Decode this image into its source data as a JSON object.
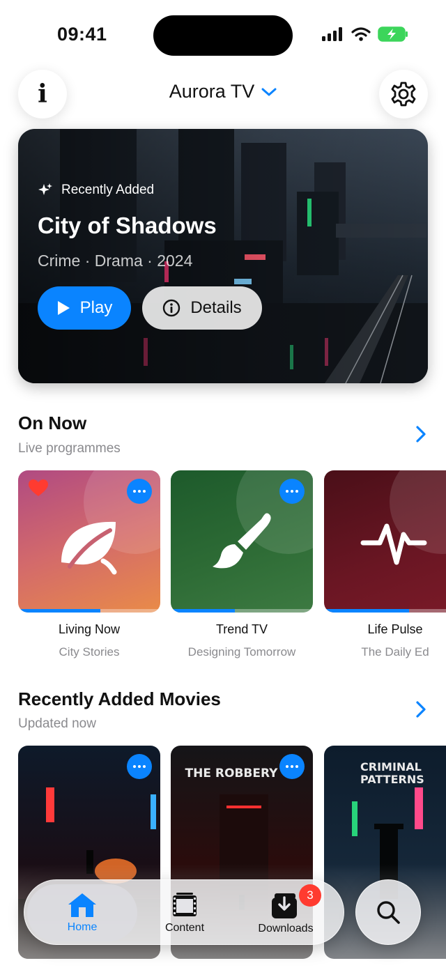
{
  "status_bar": {
    "time": "09:41"
  },
  "header": {
    "title": "Aurora TV",
    "info_icon": "info-icon",
    "settings_icon": "gear-icon"
  },
  "hero": {
    "tag": "Recently Added",
    "title": "City of Shadows",
    "meta": "Crime · Drama · 2024",
    "play_label": "Play",
    "details_label": "Details"
  },
  "on_now": {
    "title": "On Now",
    "subtitle": "Live programmes",
    "items": [
      {
        "title": "Living Now",
        "subtitle": "City Stories",
        "icon": "leaf-icon",
        "favorite": true,
        "progress": 0.58
      },
      {
        "title": "Trend TV",
        "subtitle": "Designing Tomorrow",
        "icon": "paintbrush-icon",
        "favorite": false,
        "progress": 0.45
      },
      {
        "title": "Life Pulse",
        "subtitle": "The Daily Ed",
        "icon": "waveform-icon",
        "favorite": false,
        "progress": 0.6
      }
    ]
  },
  "movies": {
    "title": "Recently Added Movies",
    "subtitle": "Updated now",
    "items": [
      {
        "poster_text": ""
      },
      {
        "poster_text": "THE ROBBERY"
      },
      {
        "poster_text": "CRIMINAL PATTERNS"
      }
    ]
  },
  "tabbar": {
    "home": "Home",
    "content": "Content",
    "downloads": "Downloads",
    "downloads_badge": "3"
  },
  "colors": {
    "accent": "#0a84ff",
    "badge": "#ff3b30",
    "heart": "#ff3b30"
  }
}
